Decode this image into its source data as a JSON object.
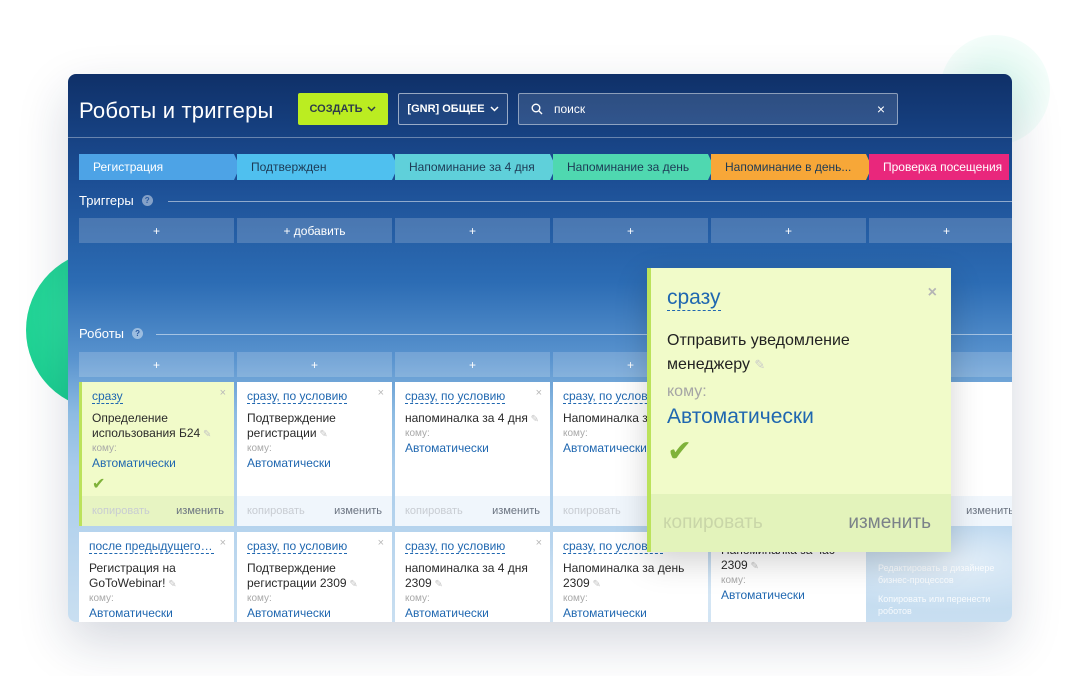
{
  "header": {
    "title": "Роботы и триггеры",
    "create_label": "СОЗДАТЬ",
    "general_label": "[GNR] ОБЩЕЕ",
    "search_value": "поиск",
    "clear_glyph": "×"
  },
  "stages": [
    {
      "label": "Регистрация",
      "bg": "#4da3e6",
      "fg": "#ffffff",
      "width": 155
    },
    {
      "label": "Подтвержден",
      "bg": "#4fc0ef",
      "fg": "#1d3a55",
      "width": 155
    },
    {
      "label": "Напоминание за 4 дня",
      "bg": "#5fd0da",
      "fg": "#1d3a55",
      "width": 155
    },
    {
      "label": "Напоминание за день",
      "bg": "#4fd8b0",
      "fg": "#1d3a55",
      "width": 155
    },
    {
      "label": "Напоминание в день...",
      "bg": "#f7a738",
      "fg": "#1d3a55",
      "width": 155
    },
    {
      "label": "Проверка посещения",
      "bg": "#e9277c",
      "fg": "#ffffff",
      "width": 140
    }
  ],
  "triggers": {
    "label": "Триггеры",
    "add_label": "+ добавить",
    "plus": "+"
  },
  "robots": {
    "label": "Роботы",
    "plus": "+"
  },
  "cards_row1": [
    {
      "when": "сразу",
      "name": "Определение использования Б24",
      "to": "кому:",
      "who": "Автоматически",
      "copy": "копировать",
      "edit": "изменить",
      "active": true
    },
    {
      "when": "сразу, по условию",
      "name": "Подтверждение регистрации",
      "to": "кому:",
      "who": "Автоматически",
      "copy": "копировать",
      "edit": "изменить"
    },
    {
      "when": "сразу, по условию",
      "name": "напоминалка за 4 дня",
      "to": "кому:",
      "who": "Автоматически",
      "copy": "копировать",
      "edit": "изменить"
    },
    {
      "when": "сразу, по условию",
      "name": "Напоминалка за день",
      "to": "кому:",
      "who": "Автоматически",
      "copy": "копировать",
      "edit": "изменить"
    },
    {
      "when": "",
      "name": "",
      "to": "",
      "who": "",
      "copy": "",
      "edit": ""
    },
    {
      "when": "",
      "name": "",
      "to": "",
      "who": "ки",
      "copy": "",
      "edit": "изменить"
    }
  ],
  "cards_row2": [
    {
      "when": "после предыдущего, ...",
      "name": "Регистрация на GoToWebinar!",
      "to": "кому:",
      "who": "Автоматически"
    },
    {
      "when": "сразу, по условию",
      "name": "Подтверждение регистрации 2309",
      "to": "кому:",
      "who": "Автоматически"
    },
    {
      "when": "сразу, по условию",
      "name": "напоминалка за 4 дня 2309",
      "to": "кому:",
      "who": "Автоматически"
    },
    {
      "when": "сразу, по условию",
      "name": "Напоминалка за день 2309",
      "to": "кому:",
      "who": "Автоматически"
    },
    {
      "when": "",
      "name": "Напоминалка за час 2309",
      "to": "кому:",
      "who": "Автоматически"
    }
  ],
  "popup": {
    "when": "сразу",
    "close": "×",
    "name": "Отправить уведомление менеджеру",
    "to": "кому:",
    "who": "Автоматически",
    "copy": "копировать",
    "edit": "изменить"
  },
  "side_menu": {
    "item1": "Редактировать в дизайнере бизнес-процессов",
    "item2": "Копировать или перенести роботов"
  }
}
